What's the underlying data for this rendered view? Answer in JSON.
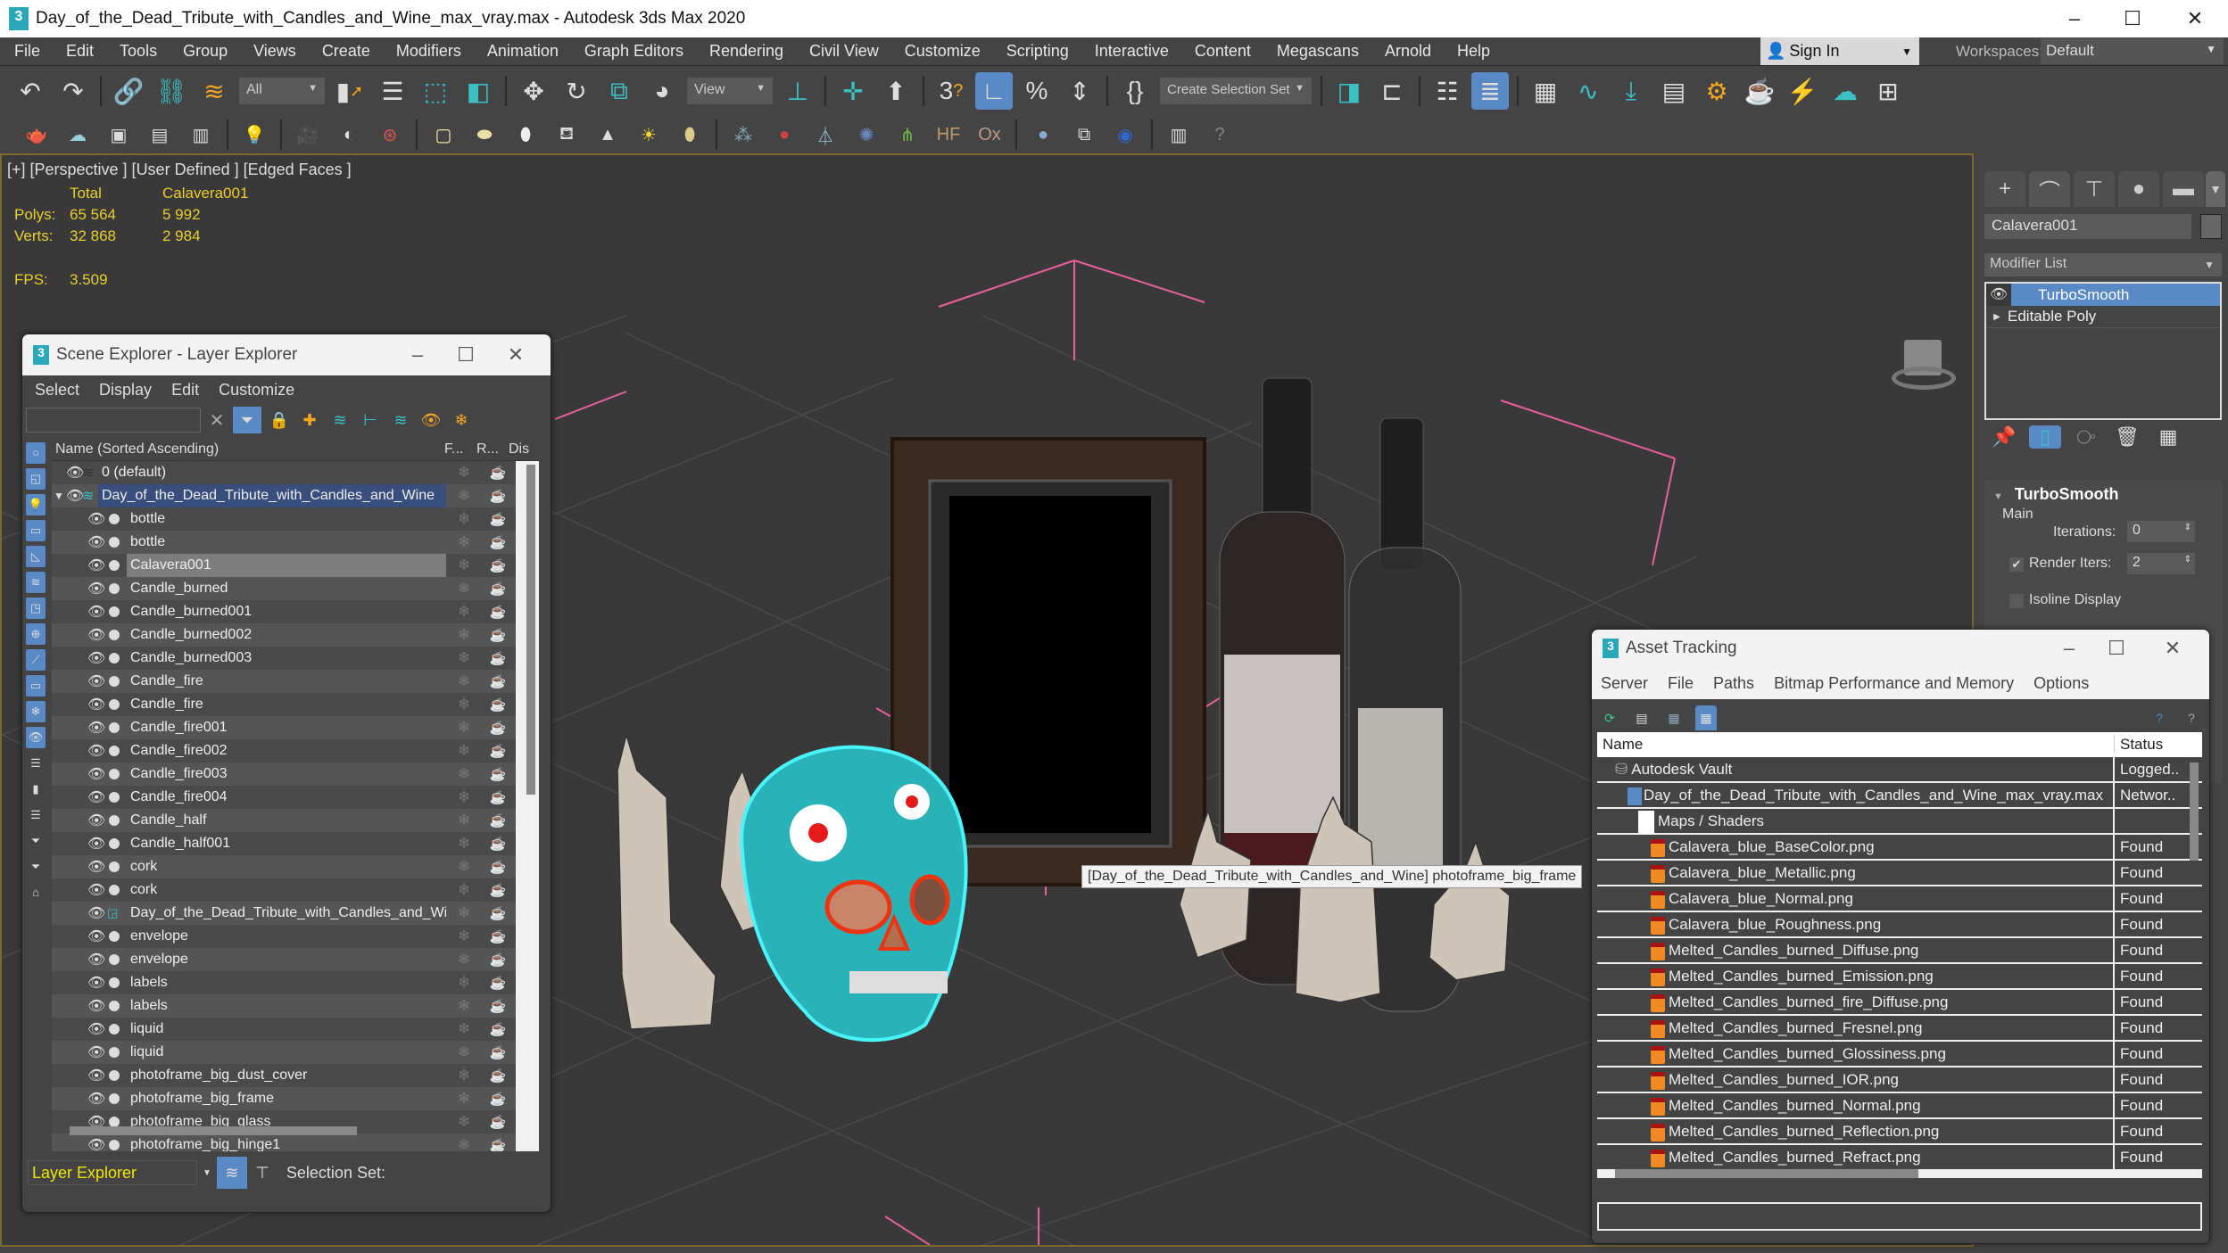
{
  "app": {
    "title": "Day_of_the_Dead_Tribute_with_Candles_and_Wine_max_vray.max - Autodesk 3ds Max 2020",
    "logo": "3",
    "window_controls": {
      "minimize": "–",
      "maximize": "☐",
      "close": "✕"
    }
  },
  "menubar": {
    "items": [
      "File",
      "Edit",
      "Tools",
      "Group",
      "Views",
      "Create",
      "Modifiers",
      "Animation",
      "Graph Editors",
      "Rendering",
      "Civil View",
      "Customize",
      "Scripting",
      "Interactive",
      "Content",
      "Megascans",
      "Arnold",
      "Help"
    ],
    "sign_in": "Sign In",
    "workspaces_label": "Workspaces:",
    "workspaces_value": "Default"
  },
  "toolbar1": {
    "selection_filter": "All",
    "reference_coord": "View",
    "selection_set_placeholder": "Create Selection Set"
  },
  "toolbar1_icons": [
    "undo-icon",
    "redo-icon",
    "link-icon",
    "unlink-icon",
    "bind-space-warp-icon",
    "select-object-icon",
    "select-by-name-icon",
    "rect-selection-icon",
    "window-crossing-icon",
    "move-icon",
    "rotate-icon",
    "scale-icon",
    "placement-icon",
    "use-pivot-icon",
    "keyboard-shortcut-icon",
    "snaps-3d-icon",
    "angle-snap-icon",
    "percent-snap-icon",
    "spinner-snap-icon",
    "edit-named-sets-icon",
    "mirror-icon",
    "align-icon",
    "scene-explorer-icon",
    "layer-explorer-icon",
    "ribbon-icon",
    "curve-editor-icon",
    "schematic-view-icon",
    "material-editor-icon",
    "render-setup-icon",
    "rendered-frame-icon",
    "render-production-icon",
    "render-cloud-icon",
    "viewport-layout-icon"
  ],
  "toolbar2_icons": [
    "teapot-icon",
    "cloud-icon",
    "render-frame-icon",
    "panel-icon",
    "settings-panel-icon",
    "light-lister-icon",
    "camera-icon",
    "camera-sequencer-icon",
    "camera-film-icon",
    "plane-light-icon",
    "dome-light-icon",
    "sphere-light-icon",
    "mesh-light-icon",
    "spot-light-icon",
    "sun-icon",
    "ies-light-icon",
    "instancer-icon",
    "fur-icon",
    "proxy-icon",
    "scatter-icon",
    "grass-icon",
    "hair-icon",
    "ox-fur-icon",
    "material-sphere-icon",
    "material-browser-icon",
    "vfb-icon",
    "file-convert-icon",
    "help-icon"
  ],
  "viewport": {
    "label": "[+] [Perspective ] [User Defined ] [Edged Faces ]",
    "stats": {
      "col_total": "Total",
      "col_selected": "Calavera001",
      "polys_label": "Polys:",
      "polys_total": "65 564",
      "polys_selected": "5 992",
      "verts_label": "Verts:",
      "verts_total": "32 868",
      "verts_selected": "2 984",
      "fps_label": "FPS:",
      "fps_value": "3.509"
    },
    "tooltip": "[Day_of_the_Dead_Tribute_with_Candles_and_Wine] photoframe_big_frame"
  },
  "scene_explorer": {
    "title": "Scene Explorer - Layer Explorer",
    "menu": [
      "Select",
      "Display",
      "Edit",
      "Customize"
    ],
    "search_value": "",
    "columns": {
      "name": "Name (Sorted Ascending)",
      "frozen": "F...",
      "render": "R...",
      "display": "Dis"
    },
    "layers": [
      {
        "name": "0 (default)",
        "type": "layer"
      },
      {
        "name": "Day_of_the_Dead_Tribute_with_Candles_and_Wine",
        "type": "layer-active"
      }
    ],
    "objects": [
      "bottle",
      "bottle",
      "Calavera001",
      "Candle_burned",
      "Candle_burned001",
      "Candle_burned002",
      "Candle_burned003",
      "Candle_fire",
      "Candle_fire",
      "Candle_fire001",
      "Candle_fire002",
      "Candle_fire003",
      "Candle_fire004",
      "Candle_half",
      "Candle_half001",
      "cork",
      "cork",
      "Day_of_the_Dead_Tribute_with_Candles_and_Wine",
      "envelope",
      "envelope",
      "labels",
      "labels",
      "liquid",
      "liquid",
      "photoframe_big_dust_cover",
      "photoframe_big_frame",
      "photoframe_big_glass",
      "photoframe_big_hinge1"
    ],
    "selected_object": "Calavera001",
    "footer": {
      "explorer_type": "Layer Explorer",
      "selection_set_label": "Selection Set:"
    }
  },
  "command_panel": {
    "object_name": "Calavera001",
    "modifier_list_label": "Modifier List",
    "stack": [
      {
        "name": "TurboSmooth",
        "selected": true
      },
      {
        "name": "Editable Poly",
        "selected": false
      }
    ],
    "rollout": {
      "title": "TurboSmooth",
      "group": "Main",
      "iterations_label": "Iterations:",
      "iterations_value": "0",
      "render_iters_label": "Render Iters:",
      "render_iters_value": "2",
      "render_iters_checked": true,
      "isoline_label": "Isoline Display",
      "isoline_checked": false
    }
  },
  "asset_tracking": {
    "title": "Asset Tracking",
    "menu": [
      "Server",
      "File",
      "Paths",
      "Bitmap Performance and Memory",
      "Options"
    ],
    "columns": {
      "name": "Name",
      "status": "Status"
    },
    "rows": [
      {
        "name": "Autodesk Vault",
        "status": "Logged..",
        "level": 0,
        "icon": "vault-icon"
      },
      {
        "name": "Day_of_the_Dead_Tribute_with_Candles_and_Wine_max_vray.max",
        "status": "Networ..",
        "level": 1,
        "icon": "max-file-icon"
      },
      {
        "name": "Maps / Shaders",
        "status": "",
        "level": 2,
        "icon": "maps-folder-icon"
      },
      {
        "name": "Calavera_blue_BaseColor.png",
        "status": "Found",
        "level": 3,
        "icon": "png-file-icon"
      },
      {
        "name": "Calavera_blue_Metallic.png",
        "status": "Found",
        "level": 3,
        "icon": "png-file-icon"
      },
      {
        "name": "Calavera_blue_Normal.png",
        "status": "Found",
        "level": 3,
        "icon": "png-file-icon"
      },
      {
        "name": "Calavera_blue_Roughness.png",
        "status": "Found",
        "level": 3,
        "icon": "png-file-icon"
      },
      {
        "name": "Melted_Candles_burned_Diffuse.png",
        "status": "Found",
        "level": 3,
        "icon": "png-file-icon"
      },
      {
        "name": "Melted_Candles_burned_Emission.png",
        "status": "Found",
        "level": 3,
        "icon": "png-file-icon"
      },
      {
        "name": "Melted_Candles_burned_fire_Diffuse.png",
        "status": "Found",
        "level": 3,
        "icon": "png-file-icon"
      },
      {
        "name": "Melted_Candles_burned_Fresnel.png",
        "status": "Found",
        "level": 3,
        "icon": "png-file-icon"
      },
      {
        "name": "Melted_Candles_burned_Glossiness.png",
        "status": "Found",
        "level": 3,
        "icon": "png-file-icon"
      },
      {
        "name": "Melted_Candles_burned_IOR.png",
        "status": "Found",
        "level": 3,
        "icon": "png-file-icon"
      },
      {
        "name": "Melted_Candles_burned_Normal.png",
        "status": "Found",
        "level": 3,
        "icon": "png-file-icon"
      },
      {
        "name": "Melted_Candles_burned_Reflection.png",
        "status": "Found",
        "level": 3,
        "icon": "png-file-icon"
      },
      {
        "name": "Melted_Candles_burned_Refract.png",
        "status": "Found",
        "level": 3,
        "icon": "png-file-icon"
      }
    ],
    "path_field_value": ""
  },
  "colors": {
    "accent_blue": "#5a8ac6",
    "teal": "#3cc0c4",
    "stats_yellow": "#e8cf2d",
    "viewport_border": "#7a6a30",
    "selection_cyan": "#3ff2f8"
  }
}
